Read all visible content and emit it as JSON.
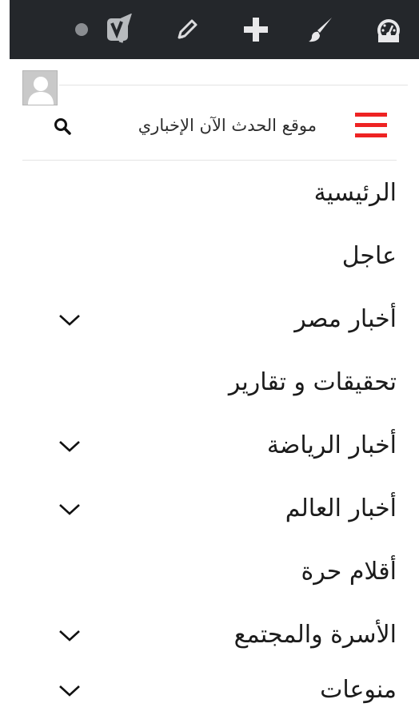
{
  "adminbar": {
    "icons": [
      "dashboard-icon",
      "customize-brush-icon",
      "new-content-plus-icon",
      "edit-pencil-icon",
      "yoast-seo-icon",
      "status-dot-icon"
    ]
  },
  "header": {
    "site_title": "موقع الحدث الآن الإخباري",
    "menu_icon": "hamburger-menu-icon",
    "search_icon": "search-icon",
    "accent_color": "#ee2323"
  },
  "menu": {
    "items": [
      {
        "label": "الرئيسية",
        "has_submenu": false
      },
      {
        "label": "عاجل",
        "has_submenu": false
      },
      {
        "label": "أخبار مصر",
        "has_submenu": true
      },
      {
        "label": "تحقيقات و تقارير",
        "has_submenu": false
      },
      {
        "label": "أخبار الرياضة",
        "has_submenu": true
      },
      {
        "label": "أخبار العالم",
        "has_submenu": true
      },
      {
        "label": "أقلام حرة",
        "has_submenu": false
      },
      {
        "label": "الأسرة والمجتمع",
        "has_submenu": true
      },
      {
        "label": "منوعات",
        "has_submenu": true
      }
    ]
  }
}
